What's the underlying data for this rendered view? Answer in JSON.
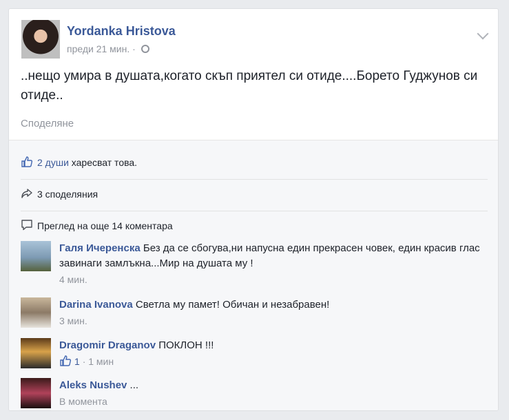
{
  "post": {
    "author": "Yordanka Hristova",
    "time": "преди 21 мин.",
    "separator": "·",
    "text": "..нещо умира в душата,когато скъп приятел си отиде....Борето Гуджунов си отиде..",
    "share_action": "Споделяне"
  },
  "feedback": {
    "likes_link": "2 души",
    "likes_rest": " харесват това.",
    "shares": "3 споделяния",
    "view_more": "Преглед на още 14 коментара"
  },
  "comments": [
    {
      "name": "Галя Ичеренска",
      "text": " Без да се сбогува,ни напусна един прекрасен човек, един красив глас завинаги замлъкна...Мир на душата му !",
      "time": "4 мин."
    },
    {
      "name": "Darina Ivanova",
      "text": " Светла му памет! Обичан и незабравен!",
      "time": "3 мин."
    },
    {
      "name": "Dragomir Draganov",
      "text": " ПОКЛОН !!!",
      "like_count": "1",
      "time": "· 1 мин"
    },
    {
      "name": "Aleks Nushev",
      "text": " ...",
      "time": "В момента"
    }
  ],
  "colors": {
    "link": "#3b5998",
    "muted": "#90949c",
    "background": "#e9ebee"
  },
  "icons": {
    "privacy": "globe-icon",
    "like": "thumbs-up-icon",
    "share": "share-arrow-icon",
    "comment": "comment-bubble-icon",
    "menu": "chevron-down-icon"
  }
}
